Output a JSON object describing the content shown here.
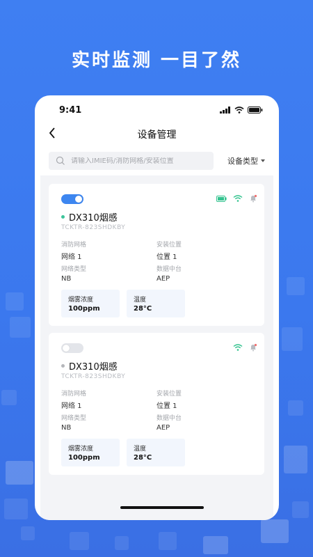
{
  "headline": "实时监测  一目了然",
  "status_bar": {
    "time": "9:41"
  },
  "nav": {
    "title": "设备管理"
  },
  "search": {
    "placeholder": "请输入IMIE码/消防网格/安装位置"
  },
  "filter": {
    "label": "设备类型"
  },
  "colors": {
    "accent": "#3d86f0",
    "online": "#3cc49a",
    "offline": "#b5b7bb",
    "battery": "#34c38f",
    "wifi": "#34c38f",
    "alarm": "#b9bcc2"
  },
  "devices": [
    {
      "enabled": true,
      "status": "online",
      "name": "DX310烟感",
      "code": "TCKTR-823SHDKBY",
      "icons": [
        "battery-icon",
        "wifi-icon",
        "alarm-bell-icon"
      ],
      "fields": [
        {
          "label": "消防网格",
          "value": "网络 1"
        },
        {
          "label": "安装位置",
          "value": "位置 1"
        },
        {
          "label": "网络类型",
          "value": "NB"
        },
        {
          "label": "数据中台",
          "value": "AEP"
        }
      ],
      "metrics": [
        {
          "label": "烟雾浓度",
          "value": "100ppm"
        },
        {
          "label": "温度",
          "value": "28°C"
        }
      ]
    },
    {
      "enabled": false,
      "status": "offline",
      "name": "DX310烟感",
      "code": "TCKTR-823SHDKBY",
      "icons": [
        "wifi-icon",
        "alarm-bell-icon"
      ],
      "fields": [
        {
          "label": "消防网格",
          "value": "网络 1"
        },
        {
          "label": "安装位置",
          "value": "位置 1"
        },
        {
          "label": "网络类型",
          "value": "NB"
        },
        {
          "label": "数据中台",
          "value": "AEP"
        }
      ],
      "metrics": [
        {
          "label": "烟雾浓度",
          "value": "100ppm"
        },
        {
          "label": "温度",
          "value": "28°C"
        }
      ]
    }
  ]
}
